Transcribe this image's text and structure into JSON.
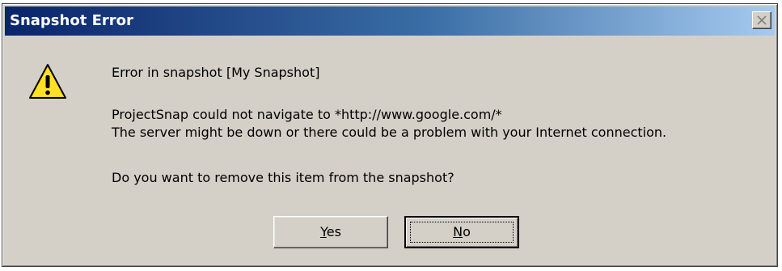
{
  "window": {
    "title": "Snapshot Error"
  },
  "message": {
    "line1": "Error in snapshot [My Snapshot]",
    "line2": "ProjectSnap could not navigate to *http://www.google.com/*",
    "line3": "The server might be down or there could be a problem with your Internet connection.",
    "line4": "Do you want to remove this item from the snapshot?"
  },
  "buttons": {
    "yes": {
      "mnemonic": "Y",
      "rest": "es"
    },
    "no": {
      "mnemonic": "N",
      "rest": "o"
    }
  },
  "icons": {
    "warning": "warning-icon",
    "close": "close-icon"
  },
  "colors": {
    "titlebar_start": "#0a246a",
    "titlebar_end": "#a6caf0",
    "dialog_face": "#d4d0c8",
    "warning_yellow": "#ffd800"
  }
}
